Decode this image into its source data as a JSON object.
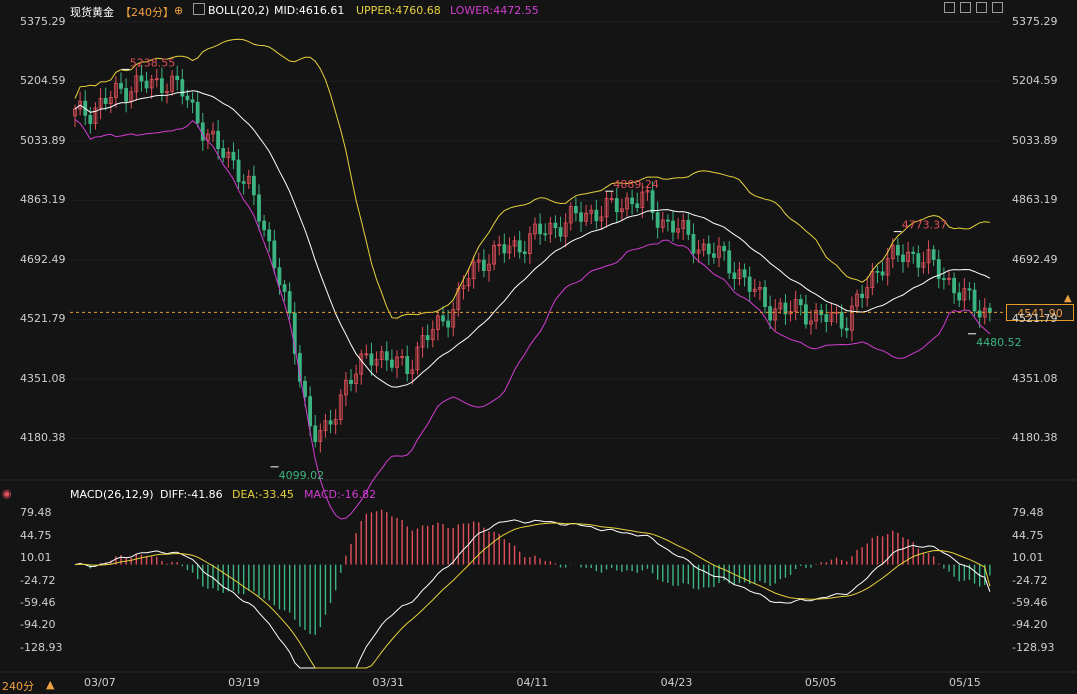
{
  "header": {
    "symbol": "现货黄金",
    "period_tag": "【240分】",
    "boll_label": "BOLL(20,2)",
    "mid_text": "MID:4616.61",
    "upper_text": "UPPER:4760.68",
    "lower_text": "LOWER:4472.55"
  },
  "macd_header": {
    "label": "MACD(26,12,9)",
    "diff_text": "DIFF:-41.86",
    "dea_text": "DEA:-33.45",
    "macd_text": "MACD:-16.82"
  },
  "footer": {
    "period": "240分"
  },
  "current_price": "4541.90",
  "colors": {
    "up": "#e0505a",
    "down": "#3cb482",
    "mid": "#ffffff",
    "upper": "#e6d23c",
    "lower": "#d23cd2",
    "diff": "#ffffff",
    "dea": "#e6d23c",
    "price_line": "#e59a2c"
  },
  "chart_data": [
    {
      "type": "candlestick",
      "indicator": "BOLL(20,2)",
      "y_ticks": [
        "5375.29",
        "5204.59",
        "5033.89",
        "4863.19",
        "4692.49",
        "4521.79",
        "4351.08",
        "4180.38"
      ],
      "x_ticks": [
        "03/07",
        "03/19",
        "03/31",
        "04/11",
        "04/23",
        "05/05",
        "05/15"
      ],
      "ylim": [
        4090,
        5380
      ],
      "annotations": [
        {
          "label": "5238.55",
          "value": 5238.55,
          "date": "03/09",
          "kind": "high"
        },
        {
          "label": "4099.02",
          "value": 4099.02,
          "date": "03/20",
          "kind": "low"
        },
        {
          "label": "4889.24",
          "value": 4889.24,
          "date": "04/17",
          "kind": "high"
        },
        {
          "label": "4773.37",
          "value": 4773.37,
          "date": "05/08",
          "kind": "high"
        },
        {
          "label": "4480.52",
          "value": 4480.52,
          "date": "05/15",
          "kind": "low"
        }
      ],
      "close_series": [
        5110,
        5120,
        5150,
        5180,
        5200,
        5190,
        5210,
        5160,
        5080,
        5010,
        4980,
        4900,
        4780,
        4640,
        4420,
        4200,
        4190,
        4330,
        4380,
        4430,
        4400,
        4380,
        4460,
        4500,
        4560,
        4650,
        4700,
        4720,
        4730,
        4760,
        4780,
        4800,
        4820,
        4830,
        4840,
        4860,
        4870,
        4810,
        4790,
        4750,
        4720,
        4700,
        4660,
        4600,
        4560,
        4540,
        4560,
        4520,
        4530,
        4520,
        4600,
        4680,
        4700,
        4710,
        4690,
        4650,
        4600,
        4560,
        4541.9
      ],
      "boll_mid_final": 4616.61,
      "boll_upper_final": 4760.68,
      "boll_lower_final": 4472.55,
      "current_price": 4541.9
    },
    {
      "type": "macd",
      "params": "26,12,9",
      "y_ticks": [
        "79.48",
        "44.75",
        "10.01",
        "-24.72",
        "-59.46",
        "-94.20",
        "-128.93"
      ],
      "ylim": [
        -160,
        100
      ],
      "diff_final": -41.86,
      "dea_final": -33.45,
      "macd_final": -16.82
    }
  ]
}
